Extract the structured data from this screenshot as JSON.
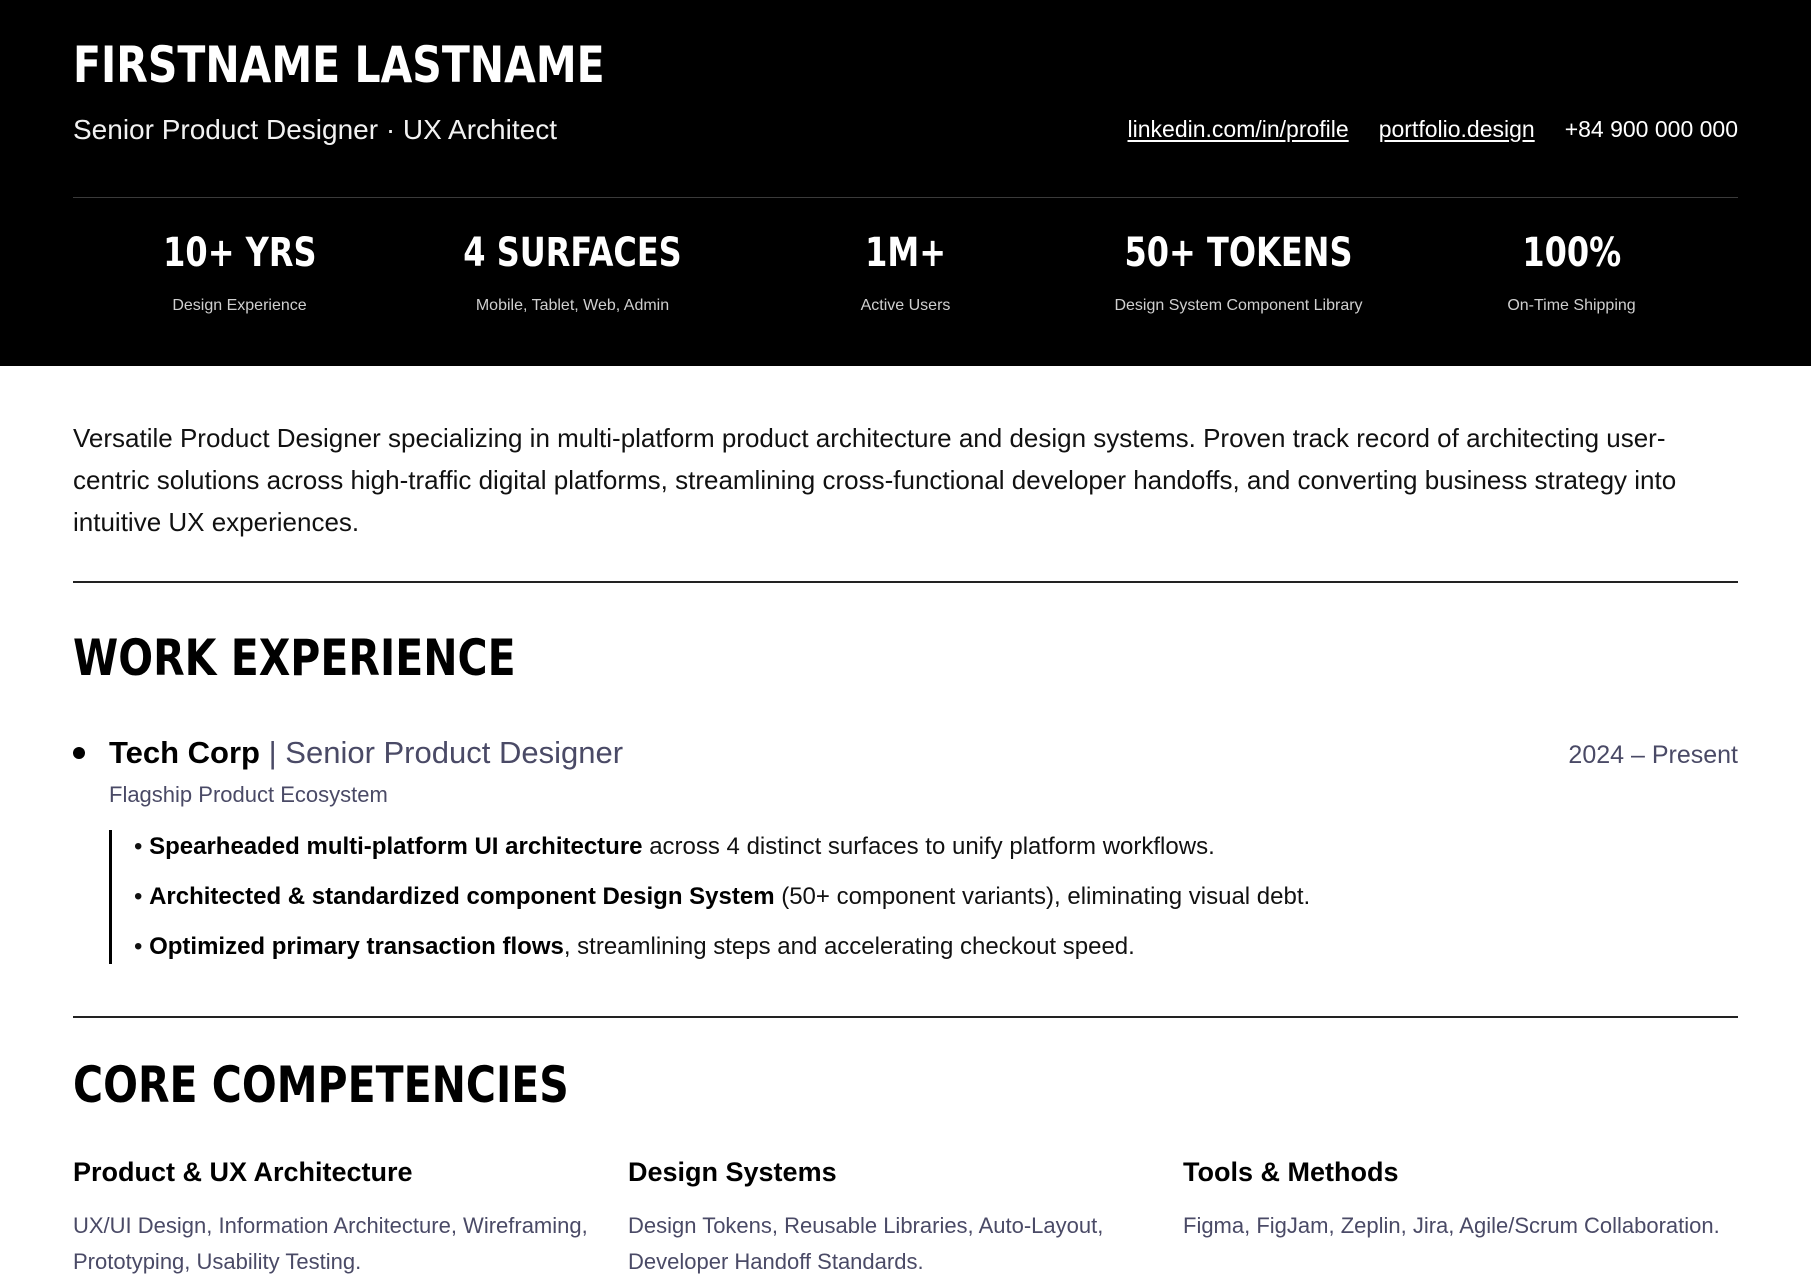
{
  "header": {
    "name": "FIRSTNAME LASTNAME",
    "role": "Senior Product Designer · UX Architect",
    "contacts": {
      "linkedin": "linkedin.com/in/profile",
      "portfolio": "portfolio.design",
      "phone": "+84 900 000 000"
    },
    "stats": [
      {
        "value": "10+ YRS",
        "label": "Design Experience"
      },
      {
        "value": "4 SURFACES",
        "label": "Mobile, Tablet, Web, Admin"
      },
      {
        "value": "1M+",
        "label": "Active Users"
      },
      {
        "value": "50+ TOKENS",
        "label": "Design System Component Library"
      },
      {
        "value": "100%",
        "label": "On-Time Shipping"
      }
    ]
  },
  "summary": "Versatile Product Designer specializing in multi-platform product architecture and design systems. Proven track record of architecting user-centric solutions across high-traffic digital platforms, streamlining cross-functional developer handoffs, and converting business strategy into intuitive UX experiences.",
  "work": {
    "title": "WORK EXPERIENCE",
    "job": {
      "company": "Tech Corp",
      "separator": " | ",
      "position": "Senior Product Designer",
      "dates": "2024 – Present",
      "subtitle": "Flagship Product Ecosystem",
      "bullets": [
        {
          "prefix": "• ",
          "bold": "Spearheaded multi-platform UI architecture",
          "rest": " across 4 distinct surfaces to unify platform workflows."
        },
        {
          "prefix": "• ",
          "bold": "Architected & standardized component Design System",
          "rest": " (50+ component variants), eliminating visual debt."
        },
        {
          "prefix": "• ",
          "bold": "Optimized primary transaction flows",
          "rest": ", streamlining steps and accelerating checkout speed."
        }
      ]
    }
  },
  "competencies": {
    "title": "CORE COMPETENCIES",
    "columns": [
      {
        "title": "Product & UX Architecture",
        "text": "UX/UI Design, Information Architecture, Wireframing, Prototyping, Usability Testing."
      },
      {
        "title": "Design Systems",
        "text": "Design Tokens, Reusable Libraries, Auto-Layout, Developer Handoff Standards."
      },
      {
        "title": "Tools & Methods",
        "text": "Figma, FigJam, Zeplin, Jira, Agile/Scrum Collaboration."
      }
    ]
  },
  "colors": {
    "header_bg": "#000000",
    "accent_muted": "#4a4a66"
  }
}
